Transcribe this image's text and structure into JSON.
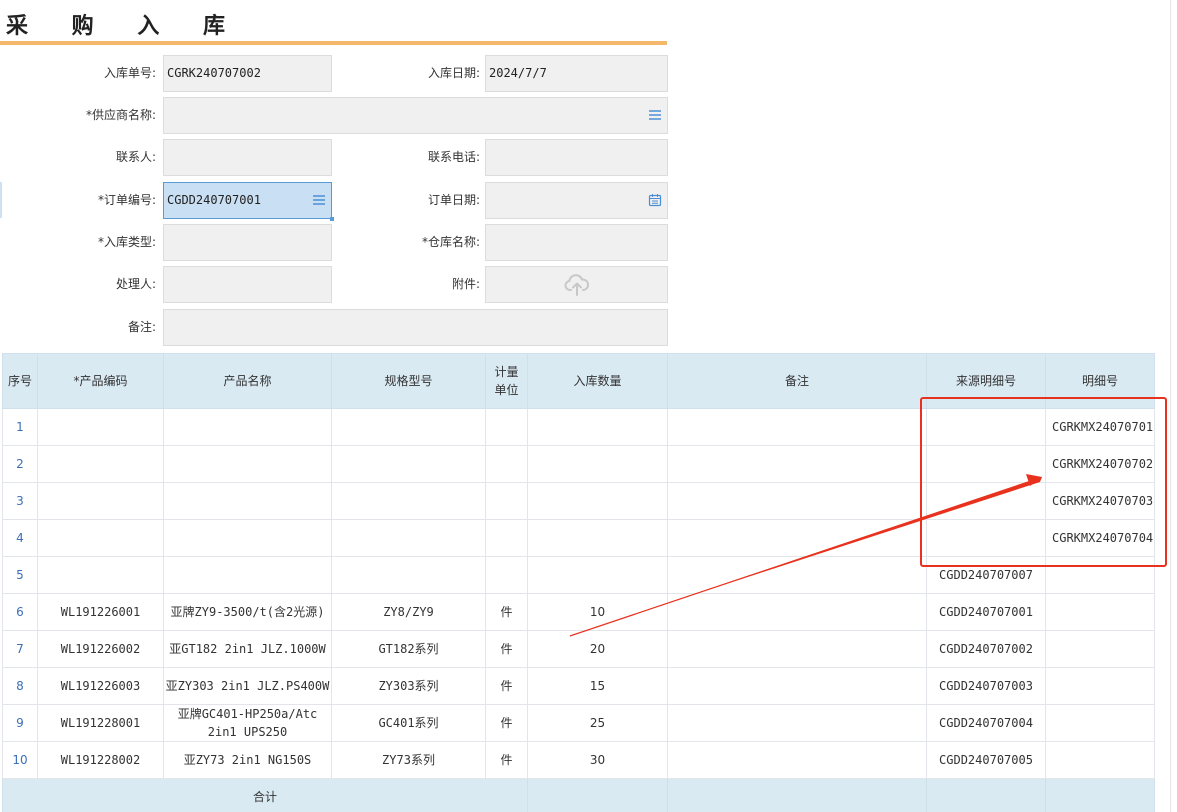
{
  "page": {
    "title": "采 购 入 库"
  },
  "form": {
    "inbound_no_label": "入库单号:",
    "inbound_no_value": "CGRK240707002",
    "inbound_date_label": "入库日期:",
    "inbound_date_value": "2024/7/7",
    "supplier_label": "*供应商名称:",
    "supplier_value": "",
    "contact_label": "联系人:",
    "contact_value": "",
    "phone_label": "联系电话:",
    "phone_value": "",
    "order_no_label": "*订单编号:",
    "order_no_value": "CGDD240707001",
    "order_date_label": "订单日期:",
    "order_date_value": "",
    "inbound_type_label": "*入库类型:",
    "inbound_type_value": "",
    "warehouse_label": "*仓库名称:",
    "warehouse_value": "",
    "handler_label": "处理人:",
    "handler_value": "",
    "attachment_label": "附件:",
    "remark_label": "备注:",
    "remark_value": ""
  },
  "icons": {
    "list": "list-icon",
    "calendar": "calendar-icon",
    "upload": "cloud-upload-icon"
  },
  "table": {
    "headers": [
      "序号",
      "*产品编码",
      "产品名称",
      "规格型号",
      "计量单位",
      "入库数量",
      "备注",
      "来源明细号",
      "明细号"
    ],
    "rows": [
      {
        "seq": "1",
        "code": "",
        "name": "",
        "spec": "",
        "unit": "",
        "qty": "",
        "remark": "",
        "source": "",
        "detail": "CGRKMX24070701"
      },
      {
        "seq": "2",
        "code": "",
        "name": "",
        "spec": "",
        "unit": "",
        "qty": "",
        "remark": "",
        "source": "",
        "detail": "CGRKMX24070702"
      },
      {
        "seq": "3",
        "code": "",
        "name": "",
        "spec": "",
        "unit": "",
        "qty": "",
        "remark": "",
        "source": "",
        "detail": "CGRKMX24070703"
      },
      {
        "seq": "4",
        "code": "",
        "name": "",
        "spec": "",
        "unit": "",
        "qty": "",
        "remark": "",
        "source": "",
        "detail": "CGRKMX24070704"
      },
      {
        "seq": "5",
        "code": "",
        "name": "",
        "spec": "",
        "unit": "",
        "qty": "",
        "remark": "",
        "source": "CGDD240707007",
        "detail": ""
      },
      {
        "seq": "6",
        "code": "WL191226001",
        "name": "亚牌ZY9-3500/t(含2光源)",
        "spec": "ZY8/ZY9",
        "unit": "件",
        "qty": "10",
        "remark": "",
        "source": "CGDD240707001",
        "detail": ""
      },
      {
        "seq": "7",
        "code": "WL191226002",
        "name": "亚GT182 2in1 JLZ.1000W",
        "spec": "GT182系列",
        "unit": "件",
        "qty": "20",
        "remark": "",
        "source": "CGDD240707002",
        "detail": ""
      },
      {
        "seq": "8",
        "code": "WL191226003",
        "name": "亚ZY303 2in1 JLZ.PS400W",
        "spec": "ZY303系列",
        "unit": "件",
        "qty": "15",
        "remark": "",
        "source": "CGDD240707003",
        "detail": ""
      },
      {
        "seq": "9",
        "code": "WL191228001",
        "name": "亚牌GC401-HP250a/Atc 2in1 UPS250",
        "spec": "GC401系列",
        "unit": "件",
        "qty": "25",
        "remark": "",
        "source": "CGDD240707004",
        "detail": ""
      },
      {
        "seq": "10",
        "code": "WL191228002",
        "name": "亚ZY73 2in1 NG150S",
        "spec": "ZY73系列",
        "unit": "件",
        "qty": "30",
        "remark": "",
        "source": "CGDD240707005",
        "detail": ""
      }
    ],
    "total_label": "合计"
  },
  "colors": {
    "annotation": "#e8321e",
    "header_bg": "#d9eaf3",
    "title_underline": "#f5b86a",
    "active_field": "#c9dff3",
    "icon_blue": "#4a8fd6"
  }
}
